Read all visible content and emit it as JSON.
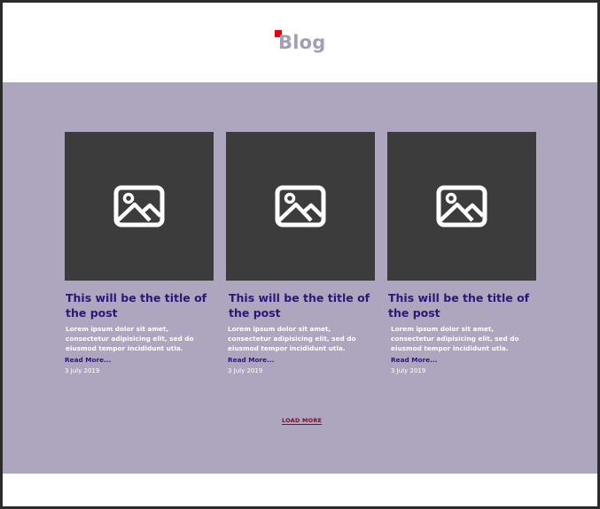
{
  "header": {
    "title": "Blog",
    "logo_color": "#e8000d",
    "title_color": "#a39eb5"
  },
  "posts": [
    {
      "image_icon": "image-placeholder-icon",
      "title": "This will be the title of the post",
      "excerpt": "Lorem ipsum dolor sit amet, consectetur adipisicing elit, sed do eiusmod tempor incididunt utla.",
      "read_more": "Read More...",
      "date": "3 July 2019"
    },
    {
      "image_icon": "image-placeholder-icon",
      "title": "This will be the title of the post",
      "excerpt": "Lorem ipsum dolor sit amet, consectetur adipisicing elit, sed do eiusmod tempor incididunt utla.",
      "read_more": "Read More...",
      "date": "3 July 2019"
    },
    {
      "image_icon": "image-placeholder-icon",
      "title": "This will be the title of the post",
      "excerpt": "Lorem ipsum dolor sit amet, consectetur adipisicing elit, sed do eiusmod tempor incididunt utla.",
      "read_more": "Read More...",
      "date": "3 July 2019"
    }
  ],
  "load_more": "LOAD MORE",
  "colors": {
    "section_bg": "#aea6be",
    "image_bg": "#3c3c3c",
    "title_text": "#2d1776",
    "load_more": "#7a0f2e"
  }
}
